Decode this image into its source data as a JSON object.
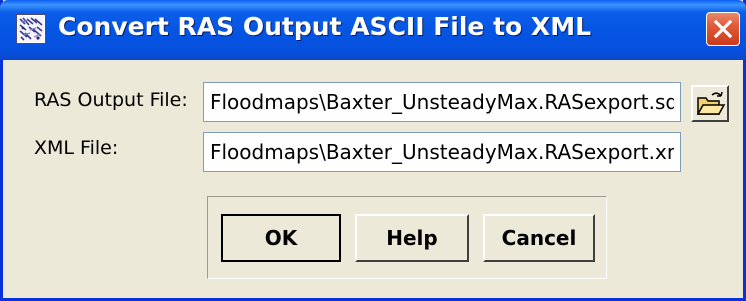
{
  "window": {
    "title": "Convert RAS Output ASCII File to XML",
    "icons": {
      "app": "ras-app-icon",
      "close": "close-icon",
      "browse": "open-folder-icon"
    }
  },
  "form": {
    "ras_output": {
      "label": "RAS Output File:",
      "value": "Floodmaps\\Baxter_UnsteadyMax.RASexport.sdf"
    },
    "xml_file": {
      "label": "XML File:",
      "value": "Floodmaps\\Baxter_UnsteadyMax.RASexport.xml"
    }
  },
  "buttons": {
    "ok": "OK",
    "help": "Help",
    "cancel": "Cancel"
  },
  "colors": {
    "titlebar": "#0554e2",
    "close": "#e15a38",
    "dialog_bg": "#ece9d8"
  }
}
